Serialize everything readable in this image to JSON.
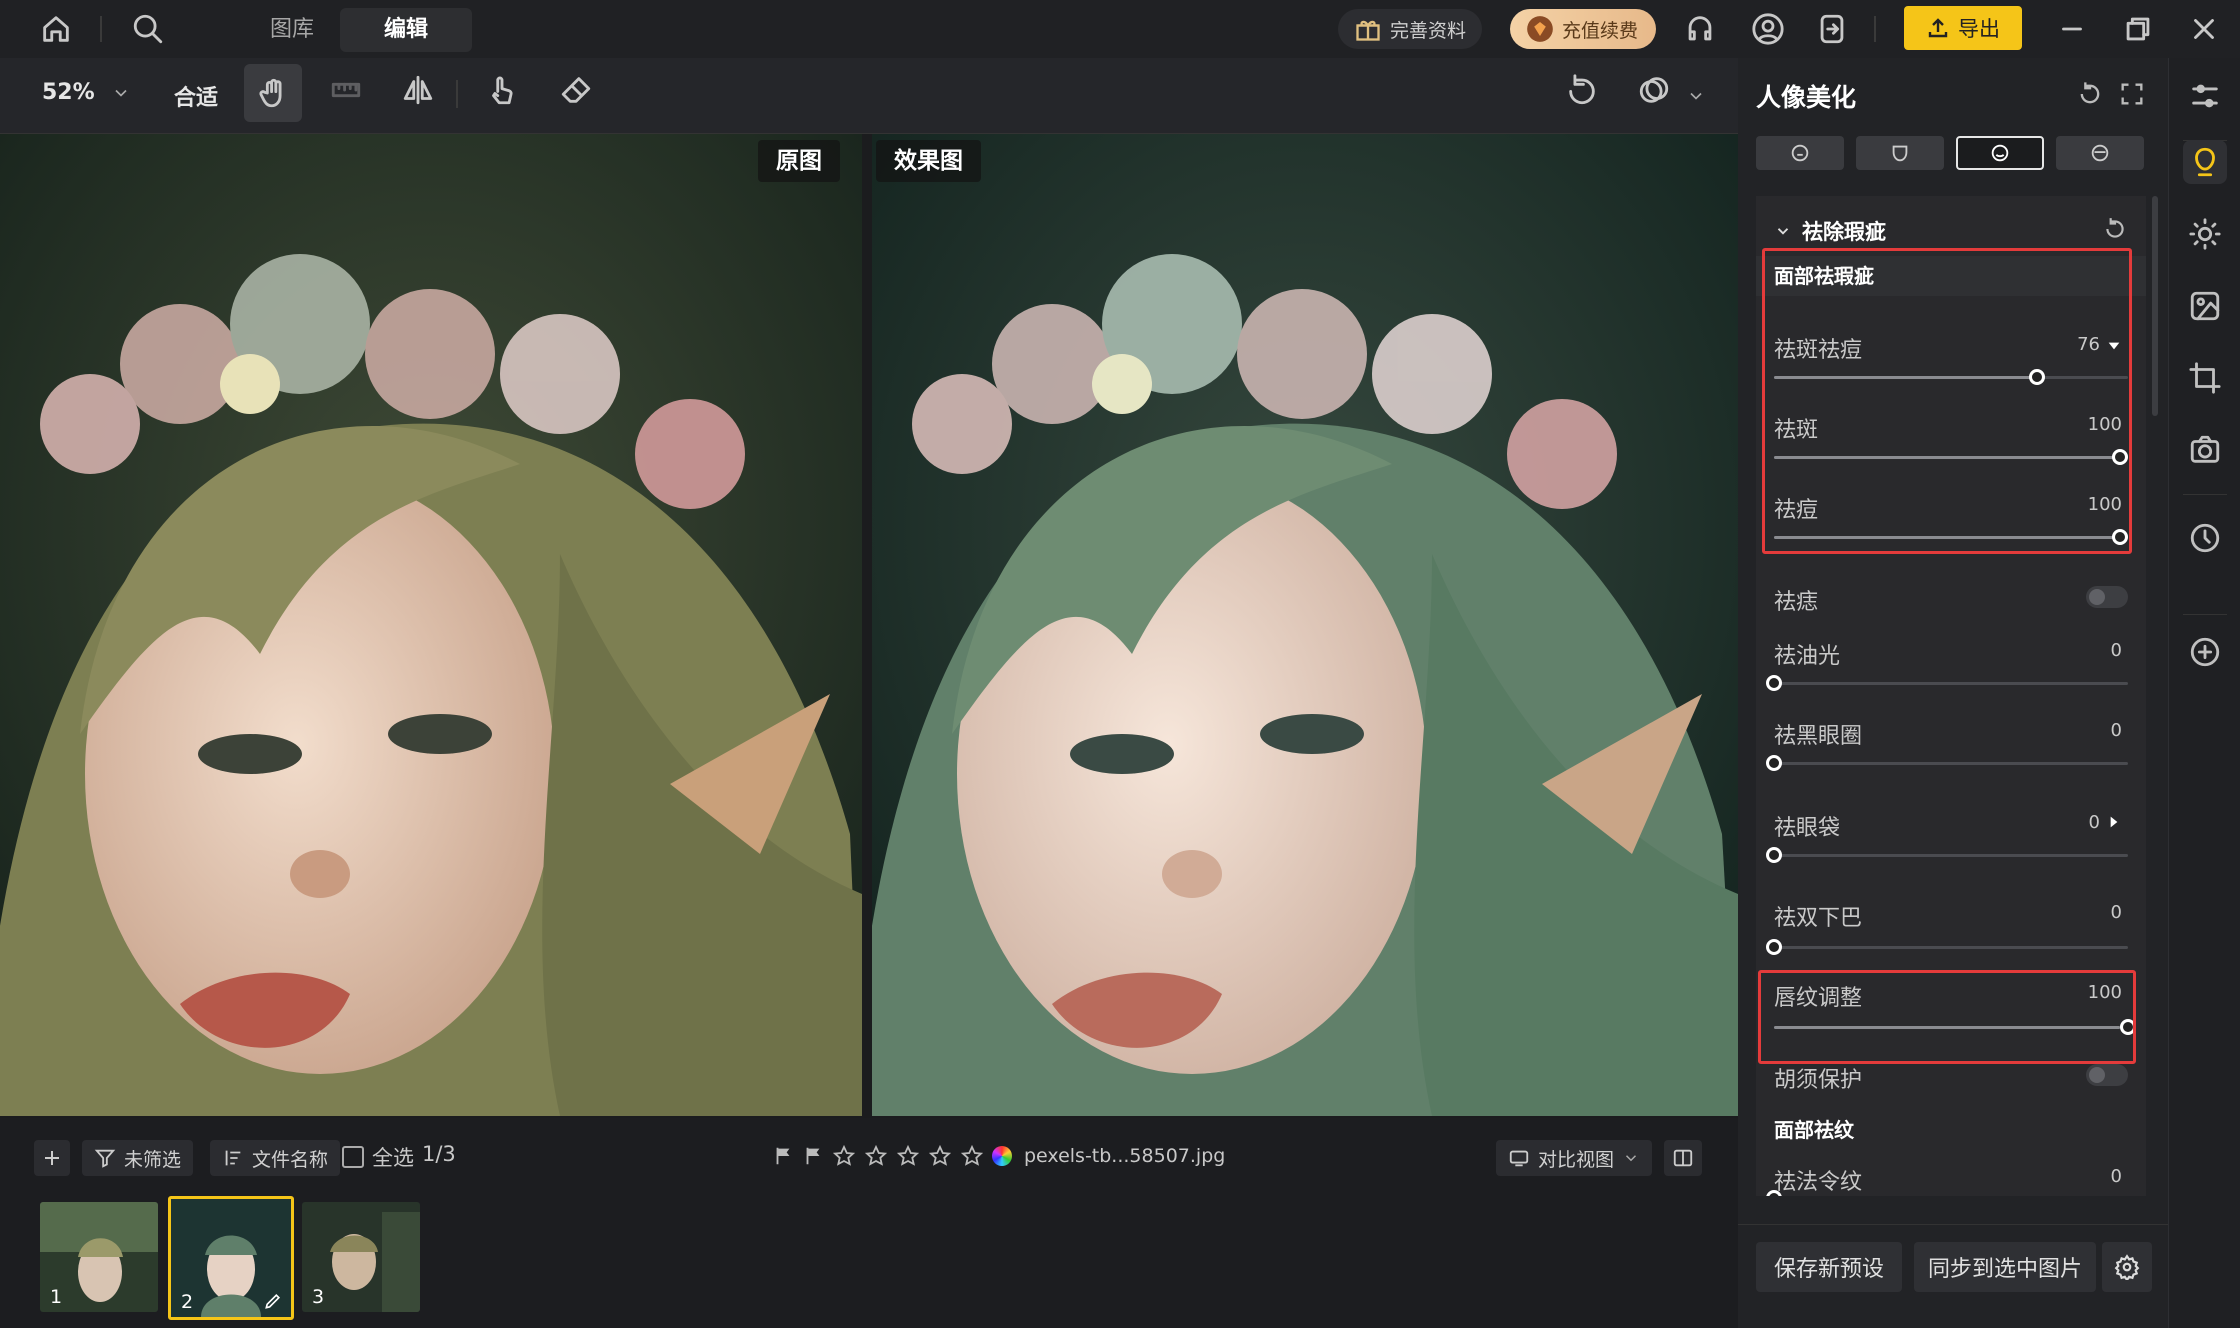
{
  "topbar": {
    "tabs": [
      {
        "label": "图库"
      },
      {
        "label": "编辑"
      }
    ],
    "complete_profile": "完善资料",
    "recharge": "充值续费",
    "export": "导出"
  },
  "toolbar": {
    "zoom": "52%",
    "fit": "合适"
  },
  "canvas": {
    "original_label": "原图",
    "result_label": "效果图"
  },
  "filmstrip": {
    "filter": "未筛选",
    "sort": "文件名称",
    "select_all": "全选",
    "count": "1/3",
    "filename": "pexels-tb...58507.jpg",
    "view_mode": "对比视图",
    "thumbs": [
      {
        "num": "1"
      },
      {
        "num": "2"
      },
      {
        "num": "3"
      }
    ],
    "selected_thumb": 2
  },
  "panel": {
    "title": "人像美化",
    "section_title": "祛除瑕疵",
    "group1_title": "面部祛瑕疵",
    "sliders": [
      {
        "label": "祛斑祛痘",
        "value": "76",
        "level": 0.76
      },
      {
        "label": "祛斑",
        "value": "100",
        "level": 1.0
      },
      {
        "label": "祛痘",
        "value": "100",
        "level": 1.0
      }
    ],
    "mole": "祛痣",
    "sliders2": [
      {
        "label": "祛油光",
        "value": "0"
      },
      {
        "label": "祛黑眼圈",
        "value": "0"
      },
      {
        "label": "祛眼袋",
        "value": "0"
      },
      {
        "label": "祛双下巴",
        "value": "0"
      }
    ],
    "lip": {
      "label": "唇纹调整",
      "value": "100"
    },
    "beard": "胡须保护",
    "wrinkle_title": "面部祛纹",
    "nasolabial": {
      "label": "祛法令纹",
      "value": "0"
    },
    "save_preset": "保存新预设",
    "sync": "同步到选中图片"
  },
  "colors": {
    "accent": "#f5c518",
    "highlight": "#e43b3b"
  }
}
